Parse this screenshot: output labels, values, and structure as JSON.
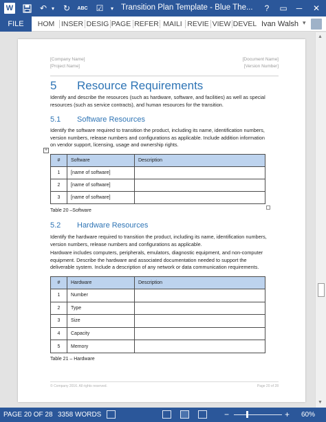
{
  "titlebar": {
    "logo_letter": "W",
    "title": "Transition Plan Template - Blue The...",
    "help": "?",
    "minimize": "─",
    "close": "✕"
  },
  "ribbon": {
    "file": "FILE",
    "tabs": [
      "HOM",
      "INSER",
      "DESIG",
      "PAGE",
      "REFER",
      "MAILI",
      "REVIE",
      "VIEW",
      "DEVEL"
    ],
    "user": "Ivan Walsh",
    "user_caret": "▾"
  },
  "document": {
    "header": {
      "company": "[Company Name]",
      "project": "[Project Name]",
      "document": "[Document Name]",
      "version": "[Version Number]"
    },
    "section": {
      "number": "5",
      "title": "Resource Requirements",
      "intro": "Identify and describe the resources (such as hardware, software, and facilities) as well as special resources (such as service contracts), and human resources for the transition."
    },
    "software": {
      "number": "5.1",
      "title": "Software Resources",
      "text": "Identify the software required to transition the product, including its name, identification numbers, version numbers, release numbers and configurations as applicable. Include addition information on vendor support, licensing, usage and ownership rights.",
      "table": {
        "headers": [
          "#",
          "Software",
          "Description"
        ],
        "rows": [
          [
            "1",
            "[name of software]",
            ""
          ],
          [
            "2",
            "[name of software]",
            ""
          ],
          [
            "3",
            "[name of software]",
            ""
          ]
        ]
      },
      "caption": "Table 20 –Software"
    },
    "hardware": {
      "number": "5.2",
      "title": "Hardware Resources",
      "text1": "Identify the hardware required to transition the product, including its name, identification numbers, version numbers, release numbers and configurations as applicable.",
      "text2": "Hardware includes computers, peripherals, emulators, diagnostic equipment, and non-computer equipment. Describe the hardware and associated documentation needed to support the deliverable system. Include a description of any network or data communication requirements.",
      "table": {
        "headers": [
          "#",
          "Hardware",
          "Description"
        ],
        "rows": [
          [
            "1",
            "Number",
            ""
          ],
          [
            "2",
            "Type",
            ""
          ],
          [
            "3",
            "Size",
            ""
          ],
          [
            "4",
            "Capacity",
            ""
          ],
          [
            "5",
            "Memory",
            ""
          ]
        ]
      },
      "caption": "Table 21 – Hardware"
    },
    "footer": {
      "left": "© Company 2016. All rights reserved.",
      "right": "Page 20 of 28"
    }
  },
  "statusbar": {
    "page": "PAGE 20 OF 28",
    "words": "3358 WORDS",
    "zoom_minus": "−",
    "zoom_plus": "+",
    "zoom": "60%"
  },
  "colors": {
    "brand": "#2b579a",
    "heading": "#2e74b5",
    "table_header": "#bdd3ee"
  }
}
